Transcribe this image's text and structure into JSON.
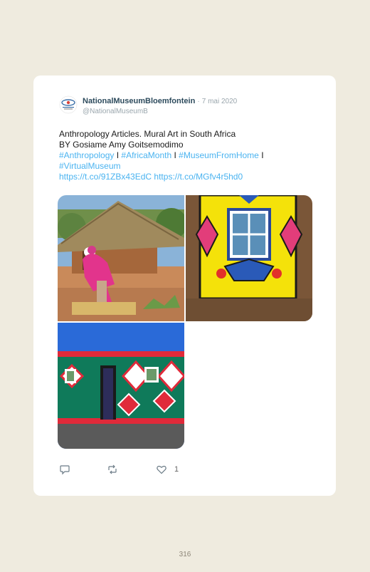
{
  "tweet": {
    "name": "NationalMuseumBloemfontein",
    "separator": "·",
    "date": "7 mai 2020",
    "handle": "@NationalMuseumB",
    "line1": "Anthropology Articles. Mural Art in South Africa",
    "line2": "BY Gosiame Amy Goitsemodimo",
    "hashtags": [
      "#Anthropology",
      "#AfricaMonth",
      "#MuseumFromHome",
      "#VirtualMuseum"
    ],
    "divider": "I",
    "links": [
      "https://t.co/91ZBx43EdC",
      "https://t.co/MGfv4r5hd0"
    ],
    "images": [
      {
        "icon": "hut-woman-photo"
      },
      {
        "icon": "painted-window-photo"
      },
      {
        "icon": "painted-wall-photo"
      }
    ],
    "actions": {
      "reply_icon": "reply-icon",
      "retweet_icon": "retweet-icon",
      "like_icon": "heart-icon",
      "like_count": "1"
    }
  },
  "page": {
    "number": "316"
  },
  "colors": {
    "link": "#4ab3f0",
    "name": "#2c4a5c",
    "background": "#efebdf"
  }
}
